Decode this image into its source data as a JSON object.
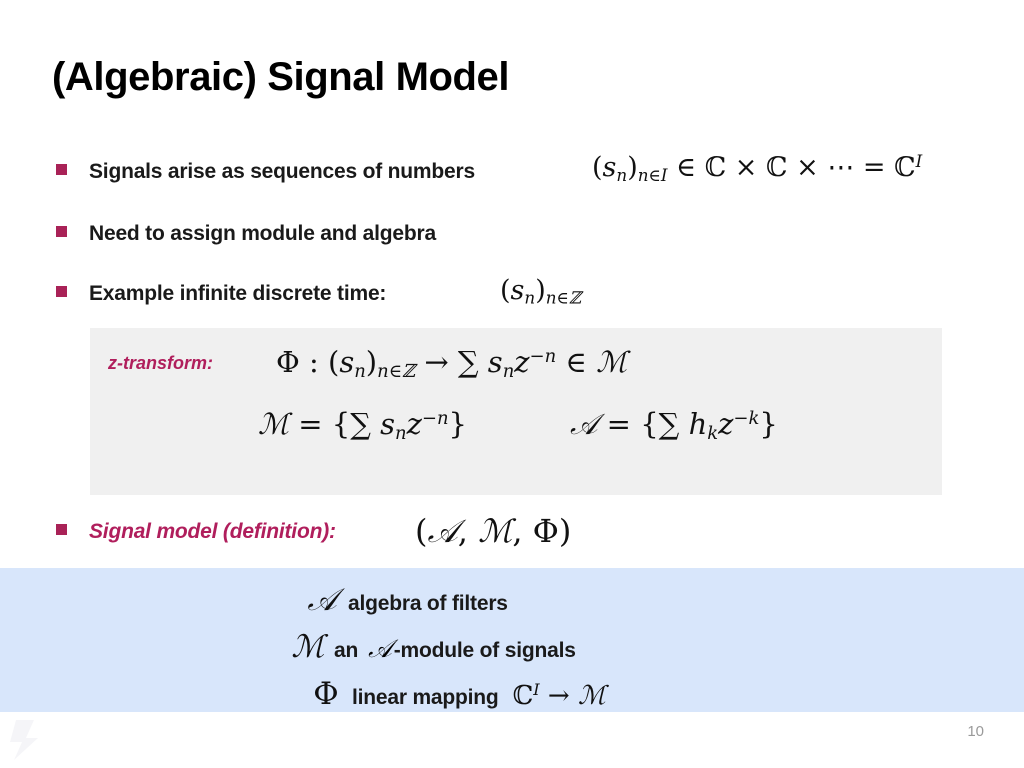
{
  "slide": {
    "title": "(Algebraic) Signal Model",
    "page_number": "10"
  },
  "colors": {
    "accent_crimson": "#B01E5C",
    "bullet_square": "#A92257",
    "gray_panel": "#F0F0F0",
    "blue_panel": "#D8E6FB",
    "title_text": "#000000",
    "page_number_text": "#9a9a9a"
  },
  "bullets": [
    {
      "label": "Signals arise as sequences of numbers",
      "style": "plain"
    },
    {
      "label": "Need to assign module and algebra",
      "style": "plain"
    },
    {
      "label": "Example infinite discrete time:",
      "style": "plain"
    },
    {
      "label": "Signal model (definition):",
      "style": "accent"
    }
  ],
  "formulas": {
    "sequence_in_complex": {
      "open_paren": "(",
      "s": "s",
      "s_sub": "n",
      "close_paren": ")",
      "index_sub": "n∈I",
      "member": "∈",
      "c1": "ℂ",
      "times1": "×",
      "c2": "ℂ",
      "times2": "×",
      "dots": "⋯",
      "equals": "=",
      "c3": "ℂ",
      "c3_sup": "I",
      "plain": "(s_n)_{n∈I} ∈ ℂ × ℂ × ⋯ = ℂ^I"
    },
    "sequence_integers": {
      "open_paren": "(",
      "s": "s",
      "s_sub": "n",
      "close_paren": ")",
      "index_sub": "n∈ℤ",
      "plain": "(s_n)_{n∈ℤ}"
    },
    "signal_model_triple": {
      "open_paren": "(",
      "algebra": "𝒜",
      "comma1": ",",
      "module": "ℳ",
      "comma2": ",",
      "phi": "Φ",
      "close_paren": ")",
      "plain": "(𝒜, ℳ, Φ)"
    }
  },
  "gray_panel": {
    "label": "z-transform:",
    "z_transform_line": {
      "phi": "Φ",
      "colon": ":",
      "open_paren": "(",
      "s": "s",
      "s_sub": "n",
      "close_paren": ")",
      "index_sub": "n∈ℤ",
      "arrow": "→",
      "sum": "∑",
      "s2": "s",
      "s2_sub": "n",
      "z": "z",
      "z_sup": "−n",
      "member": "∈",
      "module": "ℳ",
      "plain": "Φ : (s_n)_{n∈ℤ} → ∑ s_n z^{−n} ∈ ℳ"
    },
    "module_set_line": {
      "module": "ℳ",
      "equals": "=",
      "open_brace": "{",
      "sum": "∑",
      "s": "s",
      "s_sub": "n",
      "z": "z",
      "z_sup": "−n",
      "close_brace": "}",
      "plain": "ℳ = {∑ s_n z^{−n}}"
    },
    "algebra_set_line": {
      "algebra": "𝒜",
      "equals": "=",
      "open_brace": "{",
      "sum": "∑",
      "h": "h",
      "h_sub": "k",
      "z": "z",
      "z_sup": "−k",
      "close_brace": "}",
      "plain": "𝒜 = {∑ h_k z^{−k}}"
    }
  },
  "blue_panel": {
    "rows": [
      {
        "symbol": "𝒜",
        "label": "algebra of filters",
        "trailer": ""
      },
      {
        "symbol": "ℳ",
        "label_before": "an",
        "inline_symbol": "𝒜",
        "label_after": "-module of signals",
        "trailer": ""
      },
      {
        "symbol": "Φ",
        "label": "linear mapping",
        "trailer_c": "ℂ",
        "trailer_c_sup": "I",
        "trailer_arrow": "→",
        "trailer_module": "ℳ",
        "trailer_plain": "ℂ^I → ℳ"
      }
    ]
  }
}
